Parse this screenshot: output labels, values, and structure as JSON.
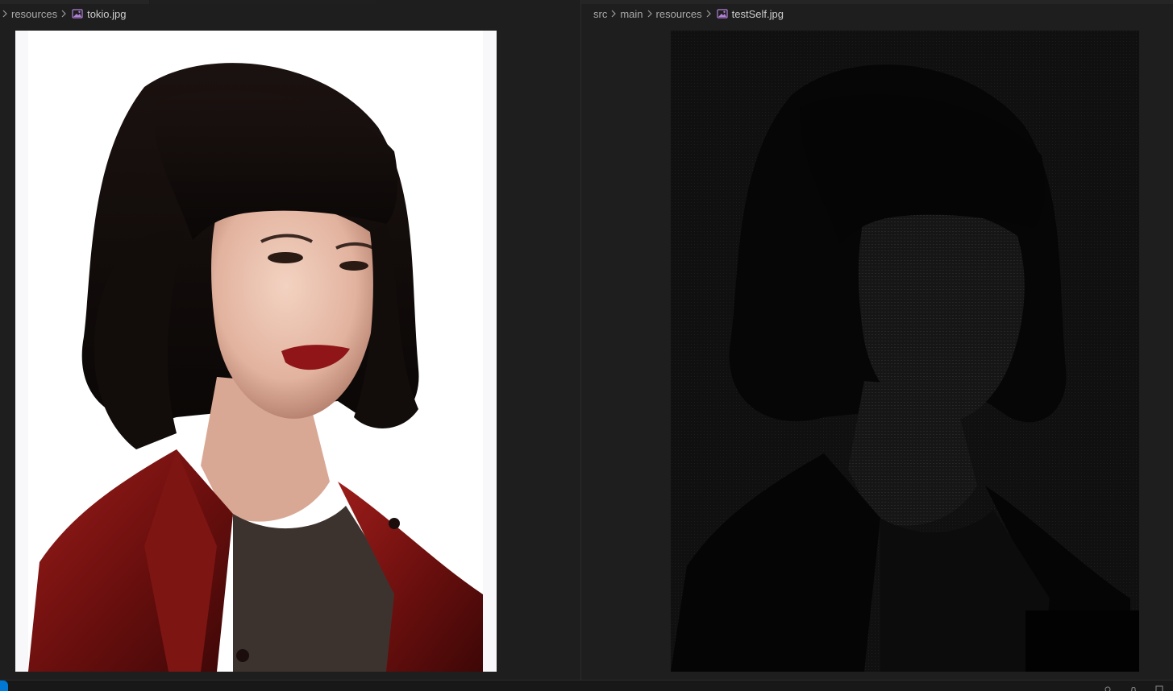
{
  "editor": {
    "left": {
      "breadcrumb": [
        "resources"
      ],
      "file": "tokio.jpg"
    },
    "right": {
      "breadcrumb": [
        "src",
        "main",
        "resources"
      ],
      "file": "testSelf.jpg"
    }
  },
  "icons": {
    "chevron": "chevron-right-icon",
    "image_file": "image-file-icon"
  },
  "colors": {
    "editor_bg": "#1e1e1e",
    "image_icon": "#b180d7",
    "statusbar_accent": "#0078d4"
  }
}
